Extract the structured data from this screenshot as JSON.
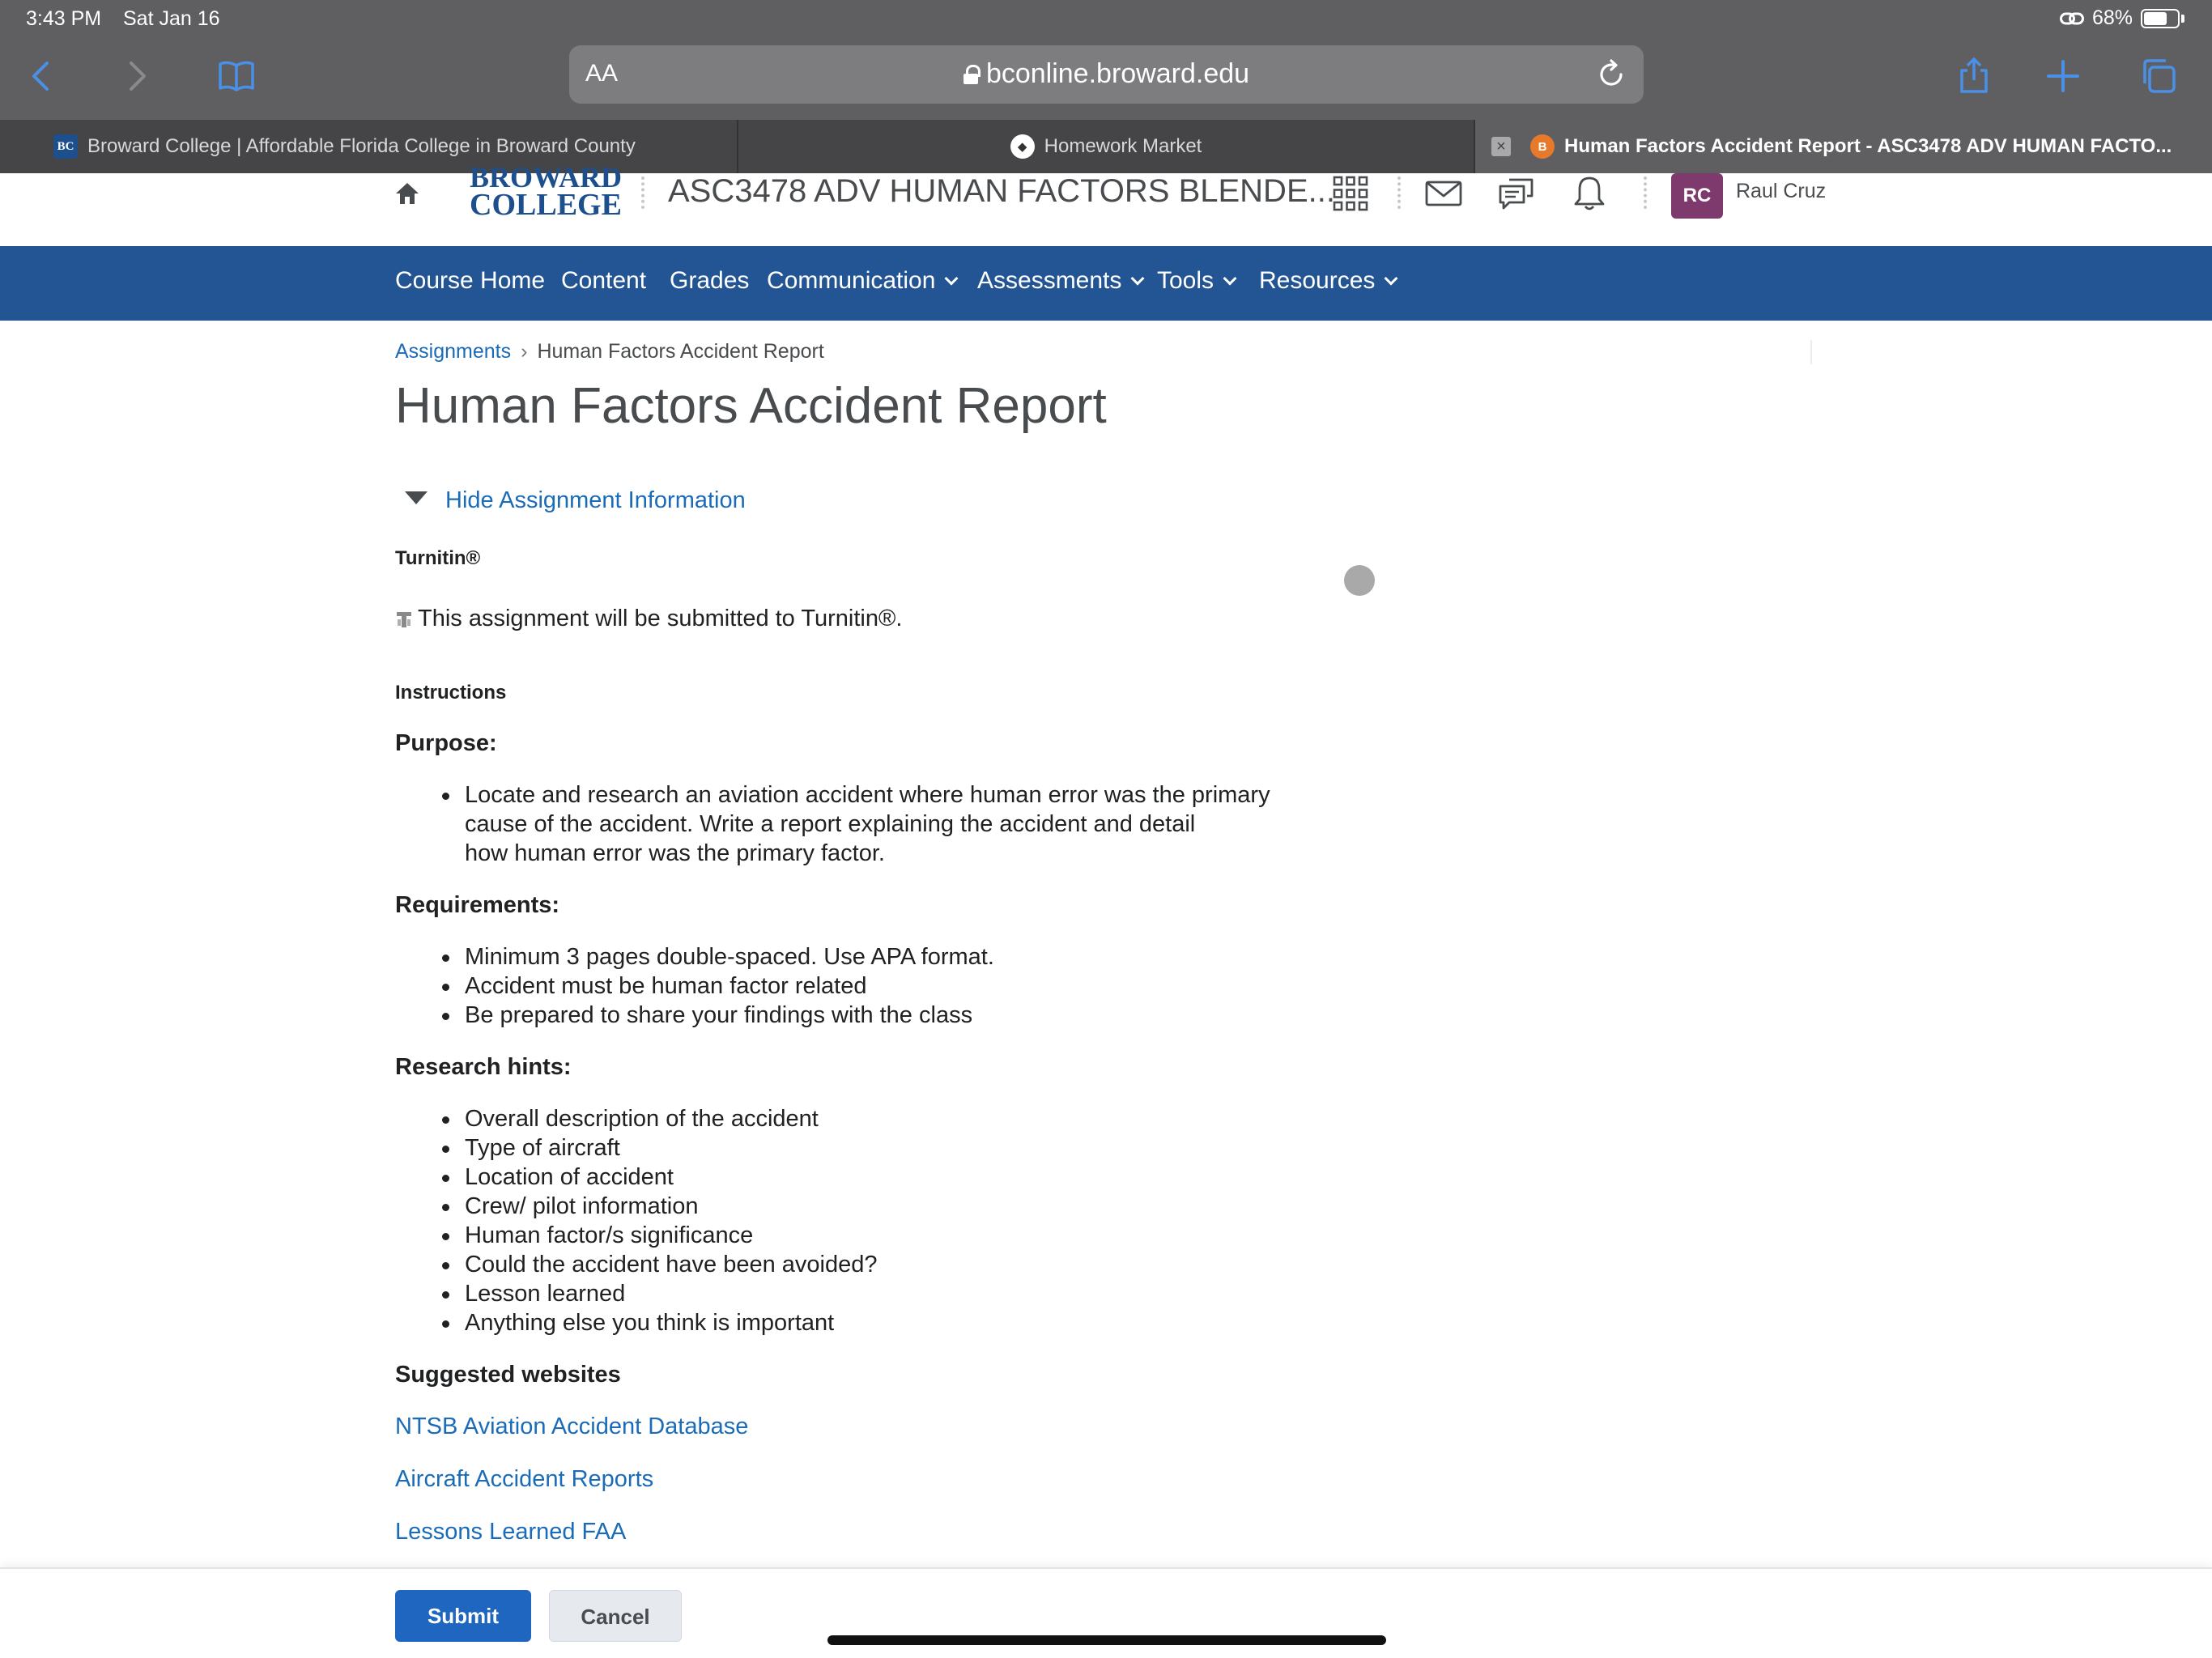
{
  "status_bar": {
    "time": "3:43 PM",
    "date": "Sat Jan 16",
    "battery": "68%"
  },
  "safari": {
    "aa_label": "AA",
    "url": "bconline.broward.edu",
    "icons": [
      "back-icon",
      "forward-icon",
      "bookmarks-icon",
      "reload-icon",
      "share-icon",
      "new-tab-icon",
      "tabs-icon"
    ]
  },
  "tabs": [
    {
      "favicon_text": "BC",
      "title": "Broward College | Affordable Florida College in Broward County",
      "active": false
    },
    {
      "favicon_text": "",
      "title": "Homework Market",
      "active": false
    },
    {
      "favicon_text": "B",
      "title": "Human Factors Accident Report - ASC3478 ADV HUMAN FACTO...",
      "active": true
    }
  ],
  "header": {
    "logo_line1": "BROWARD",
    "logo_line2": "COLLEGE",
    "course_title": "ASC3478 ADV HUMAN FACTORS BLENDE...",
    "avatar_initials": "RC",
    "user_name": "Raul Cruz"
  },
  "nav": {
    "items": [
      {
        "label": "Course Home",
        "dropdown": false
      },
      {
        "label": "Content",
        "dropdown": false
      },
      {
        "label": "Grades",
        "dropdown": false
      },
      {
        "label": "Communication",
        "dropdown": true
      },
      {
        "label": "Assessments",
        "dropdown": true
      },
      {
        "label": "Tools",
        "dropdown": true
      },
      {
        "label": "Resources",
        "dropdown": true
      }
    ]
  },
  "breadcrumb": {
    "parent": "Assignments",
    "separator": "›",
    "current": "Human Factors Accident Report"
  },
  "page": {
    "title": "Human Factors Accident Report",
    "toggle_label": "Hide Assignment Information",
    "turnitin_heading": "Turnitin®",
    "turnitin_note": "This assignment will be submitted to Turnitin®.",
    "instructions_heading": "Instructions",
    "purpose_heading": "Purpose:",
    "purpose_items": [
      "Locate and research an aviation accident where human error was the primary",
      "cause of the accident. Write a report explaining the accident and detail",
      "how human error was the primary factor."
    ],
    "requirements_heading": "Requirements:",
    "requirements_items": [
      "Minimum 3 pages double-spaced. Use APA format.",
      "Accident must be human factor related",
      "Be prepared to share your findings with the class"
    ],
    "hints_heading": "Research hints:",
    "hints_items": [
      "Overall description of the accident",
      "Type of aircraft",
      "Location of accident",
      "Crew/ pilot information",
      "Human factor/s significance",
      "Could the accident have been avoided?",
      "Lesson learned",
      "Anything else you think is important"
    ],
    "websites_heading": "Suggested websites",
    "websites": [
      "NTSB Aviation Accident Database",
      "Aircraft Accident Reports",
      "Lessons Learned FAA"
    ]
  },
  "actions": {
    "submit": "Submit",
    "cancel": "Cancel"
  },
  "colors": {
    "nav_bg": "#235494",
    "link": "#1a6bb8",
    "primary_button": "#1e66c0",
    "avatar_bg": "#7e3a6c",
    "chrome_bg": "#5f5f62"
  }
}
